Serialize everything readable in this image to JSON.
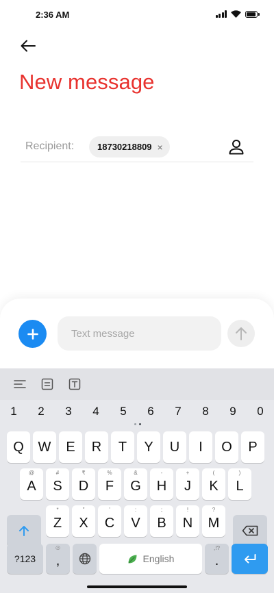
{
  "status_bar": {
    "time": "2:36 AM",
    "battery_level": 1.0
  },
  "header": {
    "back_icon": "arrow-left-icon",
    "title": "New message"
  },
  "recipient": {
    "label": "Recipient:",
    "chip_text": "18730218809",
    "remove_glyph": "×",
    "contact_icon": "person-icon"
  },
  "compose": {
    "add_icon": "plus-icon",
    "placeholder": "Text message",
    "value": "",
    "send_icon": "arrow-up-icon"
  },
  "keyboard": {
    "toolbar_icons": [
      "align-left-icon",
      "clipboard-icon",
      "text-box-icon"
    ],
    "number_row": [
      "1",
      "2",
      "3",
      "4",
      "5",
      "6",
      "7",
      "8",
      "9",
      "0"
    ],
    "row1": [
      "Q",
      "W",
      "E",
      "R",
      "T",
      "Y",
      "U",
      "I",
      "O",
      "P"
    ],
    "row2": [
      "A",
      "S",
      "D",
      "F",
      "G",
      "H",
      "J",
      "K",
      "L"
    ],
    "row2_hints": [
      "@",
      "#",
      "₹",
      "%",
      "&",
      "-",
      "+",
      "(",
      ")"
    ],
    "row3": [
      "Z",
      "X",
      "C",
      "V",
      "B",
      "N",
      "M"
    ],
    "row3_hints": [
      "*",
      "\"",
      "'",
      ":",
      ";",
      "!",
      "?"
    ],
    "symbols_label": "?123",
    "comma_label": ",",
    "comma_hint": "☺",
    "space_label": "English",
    "period_label": ".",
    "period_hint": ",!?",
    "accent_color": "#2f9bf0",
    "shift_icon": "shift-arrow-icon",
    "backspace_icon": "backspace-icon",
    "globe_icon": "globe-icon",
    "leaf_icon": "leaf-icon",
    "enter_icon": "enter-icon"
  },
  "colors": {
    "title": "#e8322e",
    "primary": "#1b8bf2"
  }
}
